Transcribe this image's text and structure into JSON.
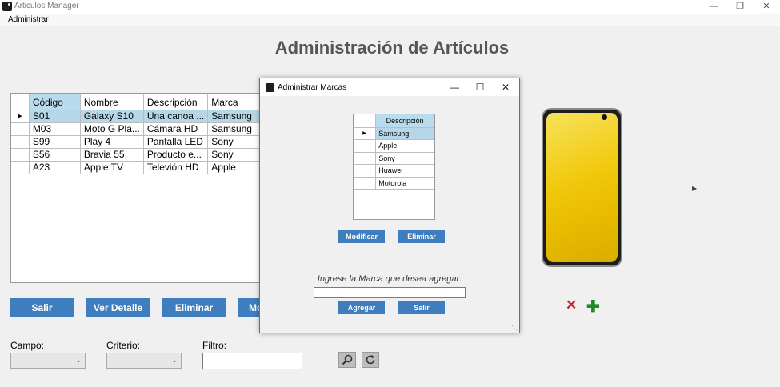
{
  "window": {
    "title": "Articulos Manager",
    "minimize": "—",
    "restore": "❐",
    "close": "✕"
  },
  "menu": {
    "administrar": "Administrar"
  },
  "main": {
    "title": "Administración de Artículos"
  },
  "articles": {
    "columns": [
      "Código",
      "Nombre",
      "Descripción",
      "Marca"
    ],
    "row_marker": "▶",
    "rows": [
      [
        "S01",
        "Galaxy S10",
        "Una canoa ...",
        "Samsung"
      ],
      [
        "M03",
        "Moto G Pla...",
        "Cámara HD",
        "Samsung"
      ],
      [
        "S99",
        "Play 4",
        "Pantalla LED",
        "Sony"
      ],
      [
        "S56",
        "Bravia 55",
        "Producto e...",
        "Sony"
      ],
      [
        "A23",
        "Apple TV",
        "Televión HD",
        "Apple"
      ]
    ]
  },
  "buttons": {
    "salir": "Salir",
    "ver_detalle": "Ver Detalle",
    "eliminar": "Eliminar",
    "modificar": "Modificar"
  },
  "filters": {
    "campo_label": "Campo:",
    "criterio_label": "Criterio:",
    "filtro_label": "Filtro:",
    "campo_value": "",
    "criterio_value": "",
    "filtro_value": ""
  },
  "icons": {
    "search": "search-icon",
    "refresh": "refresh-icon",
    "delete": "x-icon",
    "add": "plus-icon",
    "next": "arrow-right-icon"
  },
  "colors": {
    "button_blue": "#3e7dbe",
    "selection": "#b6d7e8",
    "delete_red": "#c0282d",
    "add_green": "#1f8a2a"
  },
  "dialog": {
    "title": "Administrar Marcas",
    "minimize": "—",
    "maximize": "☐",
    "close": "✕",
    "column": "Descripción",
    "row_marker": "▶",
    "brands": [
      "Samsung",
      "Apple",
      "Sony",
      "Huawei",
      "Motorola"
    ],
    "modificar": "Modificar",
    "eliminar": "Eliminar",
    "prompt": "Ingrese la Marca que desea agregar:",
    "input_value": "",
    "agregar": "Agregar",
    "salir": "Salir"
  }
}
